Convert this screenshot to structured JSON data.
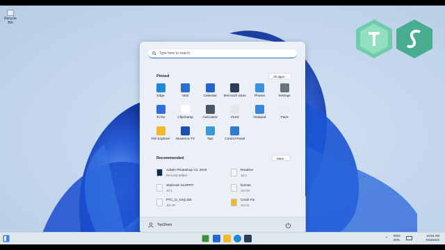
{
  "desktop": {
    "icon_label": "Recycle Bin"
  },
  "start_menu": {
    "search_placeholder": "Type here to search",
    "pinned_title": "Pinned",
    "all_apps_label": "All apps",
    "pinned_apps": [
      {
        "label": "Edge",
        "icon": "edge-icon",
        "color": "#1f8ad6"
      },
      {
        "label": "Mail",
        "icon": "mail-icon",
        "color": "#2a6fce"
      },
      {
        "label": "Calendar",
        "icon": "calendar-icon",
        "color": "#2563c9"
      },
      {
        "label": "Microsoft Store",
        "icon": "store-icon",
        "color": "#2e3d59"
      },
      {
        "label": "Photos",
        "icon": "photos-icon",
        "color": "#3b8fe0"
      },
      {
        "label": "Settings",
        "icon": "gear-icon",
        "color": "#6b7280"
      },
      {
        "label": "To Do",
        "icon": "todo-icon",
        "color": "#2f6fe0"
      },
      {
        "label": "Clipchamp",
        "icon": "clipchamp-icon",
        "color": "#ffffff"
      },
      {
        "label": "Calculator",
        "icon": "calculator-icon",
        "color": "#4b5563"
      },
      {
        "label": "Clock",
        "icon": "clock-icon",
        "color": "#e5e7eb"
      },
      {
        "label": "Notepad",
        "icon": "notepad-icon",
        "color": "#3a86d8"
      },
      {
        "label": "Paint",
        "icon": "paint-icon",
        "color": "#e8eef7"
      },
      {
        "label": "File Explorer",
        "icon": "folder-icon",
        "color": "#f2b92c"
      },
      {
        "label": "Movies & TV",
        "icon": "movies-icon",
        "color": "#1d4fb0"
      },
      {
        "label": "Tips",
        "icon": "tips-icon",
        "color": "#3a9ad9"
      },
      {
        "label": "Control Panel",
        "icon": "control-panel-icon",
        "color": "#2f7bd1"
      }
    ],
    "recommended_title": "Recommended",
    "more_label": "More",
    "recommended": [
      {
        "name": "Adobe Photoshop CC 2019",
        "sub": "Recently added",
        "icon": "photoshop-icon",
        "color": "#0f2a4a"
      },
      {
        "name": "Readme",
        "sub": "Jul 1",
        "icon": "document-icon",
        "color": "#f3f4f6"
      },
      {
        "name": "StubAxle SLDPRT",
        "sub": "Jul 1",
        "icon": "document-icon",
        "color": "#f3f4f6"
      },
      {
        "name": "license",
        "sub": "Jun 29",
        "icon": "document-icon",
        "color": "#f3f4f6"
      },
      {
        "name": "PTC_D_SSQ.dat",
        "sub": "Jun 29",
        "icon": "document-icon",
        "color": "#f3f4f6"
      },
      {
        "name": "Crack Fix",
        "sub": "Jun 21",
        "icon": "folder-icon",
        "color": "#f2b92c"
      }
    ],
    "user_name": "TopShare"
  },
  "taskbar": {
    "lang_line1": "ENG",
    "lang_line2": "INTL",
    "time": "10:53 AM",
    "date": "7/23/2022"
  },
  "colors": {
    "accent": "#2b6fd6",
    "bloom": "#1645c9"
  }
}
